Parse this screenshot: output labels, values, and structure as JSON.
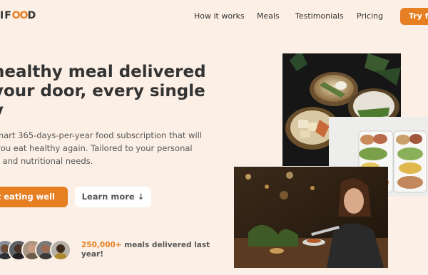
{
  "brand": {
    "logo_prefix": "IF",
    "logo_oo": "OO",
    "logo_suffix": "D"
  },
  "nav": {
    "items": [
      "How it works",
      "Meals",
      "Testimonials",
      "Pricing"
    ],
    "cta": "Try fo"
  },
  "hero": {
    "headline_lines": [
      "healthy meal delivered",
      "your door, every single",
      "y"
    ],
    "sub_lines": [
      "mart 365-days-per-year food subscription that will",
      "you eat healthy again. Tailored to your personal",
      "s and nutritional needs."
    ],
    "primary_button": "art eating well",
    "secondary_button": "Learn more ↓"
  },
  "social_proof": {
    "count": "250,000+",
    "text_line1": " meals delivered last",
    "text_line2": "year!"
  },
  "colors": {
    "accent": "#e67e22",
    "background": "#fcf0e6"
  }
}
